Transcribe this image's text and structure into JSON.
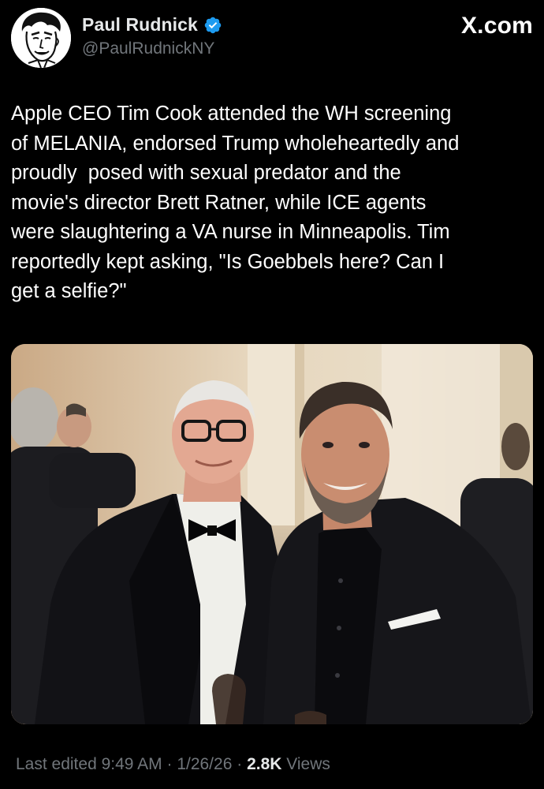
{
  "author": {
    "display_name": "Paul Rudnick",
    "handle": "@PaulRudnickNY",
    "verified": true,
    "avatar_icon": "caricature-avatar-icon"
  },
  "brand": {
    "label": "X.com"
  },
  "tweet": {
    "text": "Apple CEO Tim Cook attended the WH screening\nof MELANIA, endorsed Trump wholeheartedly and\nproudly  posed with sexual predator and the\nmovie's director Brett Ratner, while ICE agents\nwere slaughtering a VA nurse in Minneapolis. Tim\nreportedly kept asking, \"Is Goebbels here? Can I\nget a selfie?\""
  },
  "media": {
    "type": "photo"
  },
  "footer": {
    "edited_label": "Last edited 9:49 AM",
    "sep1": " · ",
    "date": "1/26/26",
    "sep2": " · ",
    "views_count": "2.8K",
    "views_label": " Views"
  },
  "colors": {
    "background": "#000000",
    "text": "#e7e9ea",
    "muted": "#71767b",
    "verified": "#1d9bf0"
  }
}
